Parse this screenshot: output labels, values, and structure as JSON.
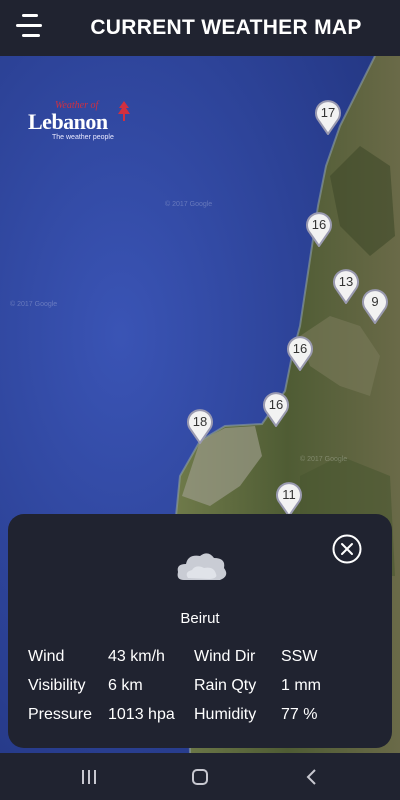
{
  "header": {
    "title": "CURRENT WEATHER MAP",
    "menu_icon": "hamburger-menu-icon"
  },
  "map": {
    "logo": {
      "small_text": "Weather of",
      "big_text": "Lebanon",
      "tagline": "The weather people"
    },
    "watermark": "© 2017 Google",
    "pins": [
      {
        "label": "17"
      },
      {
        "label": "16"
      },
      {
        "label": "13"
      },
      {
        "label": "9"
      },
      {
        "label": "16"
      },
      {
        "label": "16"
      },
      {
        "label": "18"
      },
      {
        "label": "11"
      }
    ]
  },
  "card": {
    "close_icon": "close-circle-icon",
    "weather_icon": "cloud-icon",
    "city": "Beirut",
    "details": {
      "wind_label": "Wind",
      "wind_value": "43 km/h",
      "wind_dir_label": "Wind Dir",
      "wind_dir_value": "SSW",
      "visibility_label": "Visibility",
      "visibility_value": "6 km",
      "rain_label": "Rain Qty",
      "rain_value": "1 mm",
      "pressure_label": "Pressure",
      "pressure_value": "1013 hpa",
      "humidity_label": "Humidity",
      "humidity_value": "77 %"
    }
  },
  "navbar": {
    "recents_icon": "recent-apps-icon",
    "home_icon": "home-icon",
    "back_icon": "back-icon"
  },
  "colors": {
    "header_bg": "#202330",
    "sea": "#2b3f94",
    "land": "#5a6a3c",
    "pin_fill": "#f2f2f2",
    "pin_border": "#9a9ab0"
  }
}
